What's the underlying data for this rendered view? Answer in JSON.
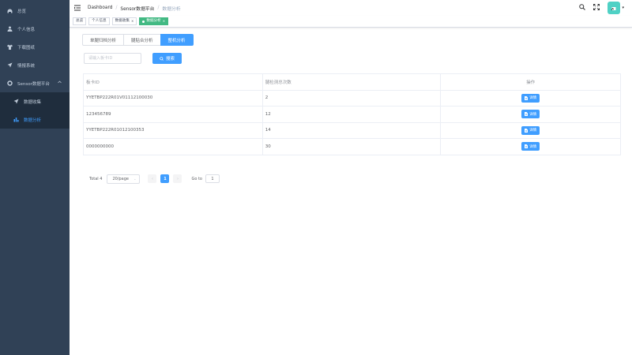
{
  "sidebar": {
    "items": [
      {
        "label": "总览",
        "icon": "dashboard-icon"
      },
      {
        "label": "个人信息",
        "icon": "user-icon"
      },
      {
        "label": "下载图纸",
        "icon": "shirt-icon"
      },
      {
        "label": "情报系统",
        "icon": "send-icon"
      },
      {
        "label": "Sensor数据平台",
        "icon": "gear-icon",
        "expanded": true
      },
      {
        "label": "数据收集",
        "icon": "send-icon"
      },
      {
        "label": "数据分析",
        "icon": "chart-icon",
        "active": true
      }
    ]
  },
  "header": {
    "breadcrumb": [
      "Dashboard",
      "Sensor数据平台",
      "数据分析"
    ]
  },
  "tags": [
    {
      "label": "总览"
    },
    {
      "label": "个人信息"
    },
    {
      "label": "数据收集",
      "closable": true
    },
    {
      "label": "数据分析",
      "active": true,
      "closable": true
    }
  ],
  "main": {
    "analysis_tabs": [
      "单腿归档分析",
      "腿贴合分析",
      "整机分析"
    ],
    "active_tab": 2,
    "search": {
      "placeholder": "请输入板卡ID",
      "button_label": "搜索"
    },
    "table": {
      "columns": [
        "板卡ID",
        "腿检测总次数",
        "操作"
      ],
      "rows": [
        {
          "id": "YYETBP222R01V01112100030",
          "count": "2",
          "action": "详情"
        },
        {
          "id": "123456789",
          "count": "12",
          "action": "详情"
        },
        {
          "id": "YYETBP222R01012100353",
          "count": "14",
          "action": "详情"
        },
        {
          "id": "0000000000",
          "count": "30",
          "action": "详情"
        }
      ]
    },
    "pagination": {
      "total": "Total 4",
      "page_size": "20/page",
      "current_page": "1",
      "goto_label": "Go to",
      "goto_value": "1"
    }
  },
  "colors": {
    "sidebar_bg": "#304156",
    "primary": "#409eff",
    "tag_active": "#42b983"
  }
}
